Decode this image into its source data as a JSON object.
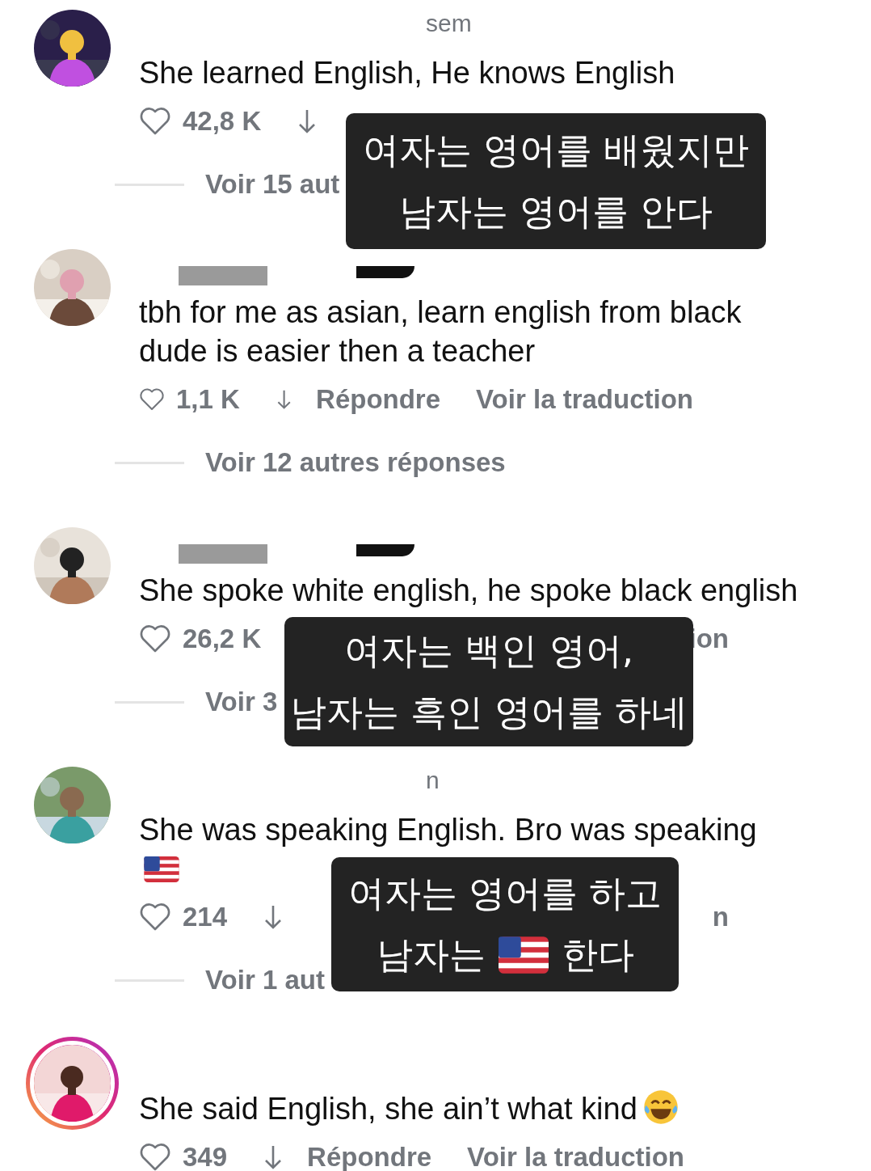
{
  "comments": [
    {
      "kind": "plain",
      "name_fragment": "sem",
      "redacted": false,
      "story_ring": false,
      "text": "She learned English, He knows English",
      "likes": "42,8 K",
      "arrow": true,
      "replies": "Voir 15 aut"
    },
    {
      "kind": "plain",
      "redacted": true,
      "story_ring": false,
      "text": "tbh for me as asian, learn english from black dude is easier then a teacher",
      "likes": "1,1 K",
      "arrow": true,
      "reply": "Répondre",
      "translate": "Voir la traduction",
      "replies": "Voir 12 autres réponses"
    },
    {
      "kind": "plain",
      "redacted": true,
      "story_ring": false,
      "text": "She spoke white english, he spoke black english",
      "likes": "26,2 K",
      "arrow": false,
      "tail": "ion",
      "replies": "Voir 3"
    },
    {
      "kind": "flagged",
      "name_fragment": "n",
      "redacted": false,
      "story_ring": false,
      "text": "She was speaking English. Bro was speaking",
      "likes": "214",
      "arrow": true,
      "tail": "n",
      "replies": "Voir 1 aut"
    },
    {
      "kind": "laughing",
      "redacted": false,
      "story_ring": true,
      "text": "She said English, she ain’t what kind",
      "likes": "349",
      "arrow": true,
      "reply": "Répondre",
      "translate": "Voir la traduction"
    }
  ],
  "captions": [
    {
      "lines": [
        [
          {
            "kind": "text",
            "text": "여자는 영어를 배웠지만"
          }
        ],
        [
          {
            "kind": "text",
            "text": "남자는 영어를 안다"
          }
        ]
      ]
    },
    {
      "lines": [
        [
          {
            "kind": "text",
            "text": "여자는 백인 영어,"
          }
        ],
        [
          {
            "kind": "text",
            "text": "남자는 흑인 영어를 하네"
          }
        ]
      ]
    },
    {
      "lines": [
        [
          {
            "kind": "text",
            "text": "여자는 영어를 하고"
          }
        ],
        [
          {
            "kind": "text",
            "text": "남자는"
          },
          {
            "kind": "flag"
          },
          {
            "kind": "text",
            "text": "한다"
          }
        ]
      ]
    }
  ]
}
